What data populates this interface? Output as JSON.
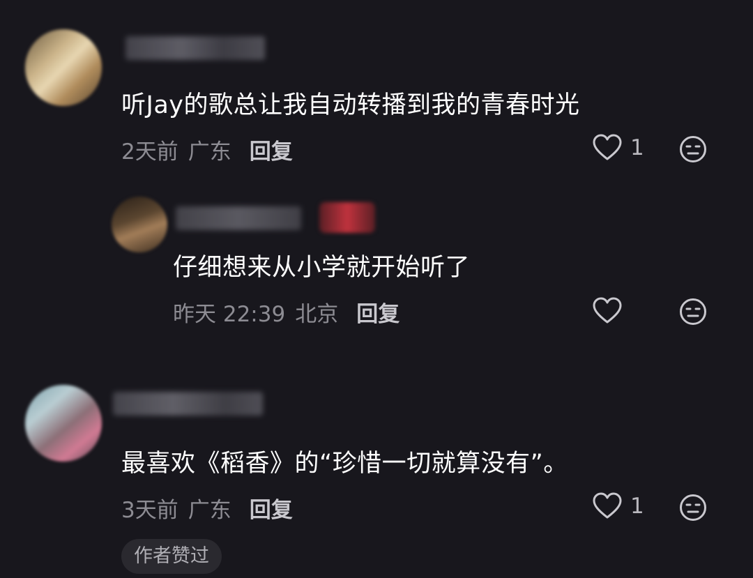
{
  "comments": [
    {
      "text": "听Jay的歌总让我自动转播到我的青春时光",
      "time": "2天前",
      "location": "广东",
      "reply_label": "回复",
      "like_count": "1"
    },
    {
      "text": "仔细想来从小学就开始听了",
      "time": "昨天 22:39",
      "location": "北京",
      "reply_label": "回复",
      "like_count": ""
    },
    {
      "text": "最喜欢《稻香》的“珍惜一切就算没有”。",
      "time": "3天前",
      "location": "广东",
      "reply_label": "回复",
      "like_count": "1",
      "author_liked": "作者赞过"
    }
  ],
  "icons": {
    "like": "heart-outline-icon",
    "emoji": "neutral-face-icon"
  },
  "colors": {
    "background": "#18171d",
    "primary_text": "#ffffff",
    "meta_text": "#8d8c93",
    "reply_text": "#c9c8ce"
  }
}
